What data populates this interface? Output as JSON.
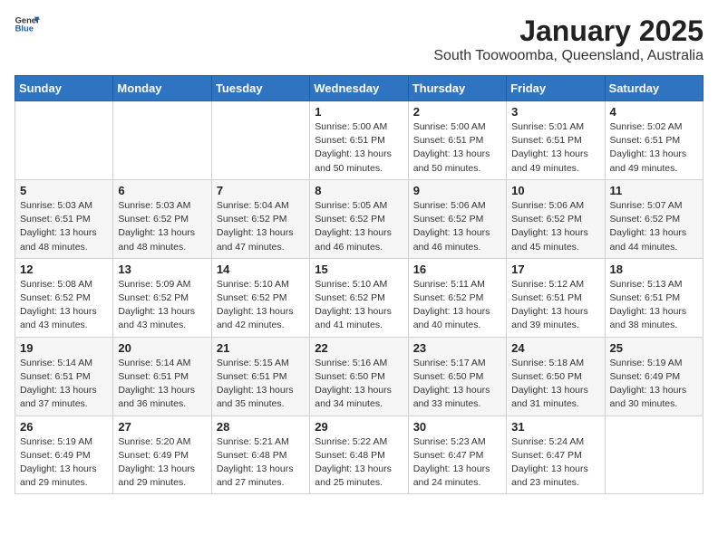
{
  "logo": {
    "text_general": "General",
    "text_blue": "Blue"
  },
  "header": {
    "month": "January 2025",
    "location": "South Toowoomba, Queensland, Australia"
  },
  "weekdays": [
    "Sunday",
    "Monday",
    "Tuesday",
    "Wednesday",
    "Thursday",
    "Friday",
    "Saturday"
  ],
  "weeks": [
    [
      null,
      null,
      null,
      {
        "day": 1,
        "sunrise": "5:00 AM",
        "sunset": "6:51 PM",
        "daylight": "13 hours and 50 minutes."
      },
      {
        "day": 2,
        "sunrise": "5:00 AM",
        "sunset": "6:51 PM",
        "daylight": "13 hours and 50 minutes."
      },
      {
        "day": 3,
        "sunrise": "5:01 AM",
        "sunset": "6:51 PM",
        "daylight": "13 hours and 49 minutes."
      },
      {
        "day": 4,
        "sunrise": "5:02 AM",
        "sunset": "6:51 PM",
        "daylight": "13 hours and 49 minutes."
      }
    ],
    [
      {
        "day": 5,
        "sunrise": "5:03 AM",
        "sunset": "6:51 PM",
        "daylight": "13 hours and 48 minutes."
      },
      {
        "day": 6,
        "sunrise": "5:03 AM",
        "sunset": "6:52 PM",
        "daylight": "13 hours and 48 minutes."
      },
      {
        "day": 7,
        "sunrise": "5:04 AM",
        "sunset": "6:52 PM",
        "daylight": "13 hours and 47 minutes."
      },
      {
        "day": 8,
        "sunrise": "5:05 AM",
        "sunset": "6:52 PM",
        "daylight": "13 hours and 46 minutes."
      },
      {
        "day": 9,
        "sunrise": "5:06 AM",
        "sunset": "6:52 PM",
        "daylight": "13 hours and 46 minutes."
      },
      {
        "day": 10,
        "sunrise": "5:06 AM",
        "sunset": "6:52 PM",
        "daylight": "13 hours and 45 minutes."
      },
      {
        "day": 11,
        "sunrise": "5:07 AM",
        "sunset": "6:52 PM",
        "daylight": "13 hours and 44 minutes."
      }
    ],
    [
      {
        "day": 12,
        "sunrise": "5:08 AM",
        "sunset": "6:52 PM",
        "daylight": "13 hours and 43 minutes."
      },
      {
        "day": 13,
        "sunrise": "5:09 AM",
        "sunset": "6:52 PM",
        "daylight": "13 hours and 43 minutes."
      },
      {
        "day": 14,
        "sunrise": "5:10 AM",
        "sunset": "6:52 PM",
        "daylight": "13 hours and 42 minutes."
      },
      {
        "day": 15,
        "sunrise": "5:10 AM",
        "sunset": "6:52 PM",
        "daylight": "13 hours and 41 minutes."
      },
      {
        "day": 16,
        "sunrise": "5:11 AM",
        "sunset": "6:52 PM",
        "daylight": "13 hours and 40 minutes."
      },
      {
        "day": 17,
        "sunrise": "5:12 AM",
        "sunset": "6:51 PM",
        "daylight": "13 hours and 39 minutes."
      },
      {
        "day": 18,
        "sunrise": "5:13 AM",
        "sunset": "6:51 PM",
        "daylight": "13 hours and 38 minutes."
      }
    ],
    [
      {
        "day": 19,
        "sunrise": "5:14 AM",
        "sunset": "6:51 PM",
        "daylight": "13 hours and 37 minutes."
      },
      {
        "day": 20,
        "sunrise": "5:14 AM",
        "sunset": "6:51 PM",
        "daylight": "13 hours and 36 minutes."
      },
      {
        "day": 21,
        "sunrise": "5:15 AM",
        "sunset": "6:51 PM",
        "daylight": "13 hours and 35 minutes."
      },
      {
        "day": 22,
        "sunrise": "5:16 AM",
        "sunset": "6:50 PM",
        "daylight": "13 hours and 34 minutes."
      },
      {
        "day": 23,
        "sunrise": "5:17 AM",
        "sunset": "6:50 PM",
        "daylight": "13 hours and 33 minutes."
      },
      {
        "day": 24,
        "sunrise": "5:18 AM",
        "sunset": "6:50 PM",
        "daylight": "13 hours and 31 minutes."
      },
      {
        "day": 25,
        "sunrise": "5:19 AM",
        "sunset": "6:49 PM",
        "daylight": "13 hours and 30 minutes."
      }
    ],
    [
      {
        "day": 26,
        "sunrise": "5:19 AM",
        "sunset": "6:49 PM",
        "daylight": "13 hours and 29 minutes."
      },
      {
        "day": 27,
        "sunrise": "5:20 AM",
        "sunset": "6:49 PM",
        "daylight": "13 hours and 29 minutes."
      },
      {
        "day": 28,
        "sunrise": "5:21 AM",
        "sunset": "6:48 PM",
        "daylight": "13 hours and 27 minutes."
      },
      {
        "day": 29,
        "sunrise": "5:22 AM",
        "sunset": "6:48 PM",
        "daylight": "13 hours and 25 minutes."
      },
      {
        "day": 30,
        "sunrise": "5:23 AM",
        "sunset": "6:47 PM",
        "daylight": "13 hours and 24 minutes."
      },
      {
        "day": 31,
        "sunrise": "5:24 AM",
        "sunset": "6:47 PM",
        "daylight": "13 hours and 23 minutes."
      },
      null
    ]
  ]
}
